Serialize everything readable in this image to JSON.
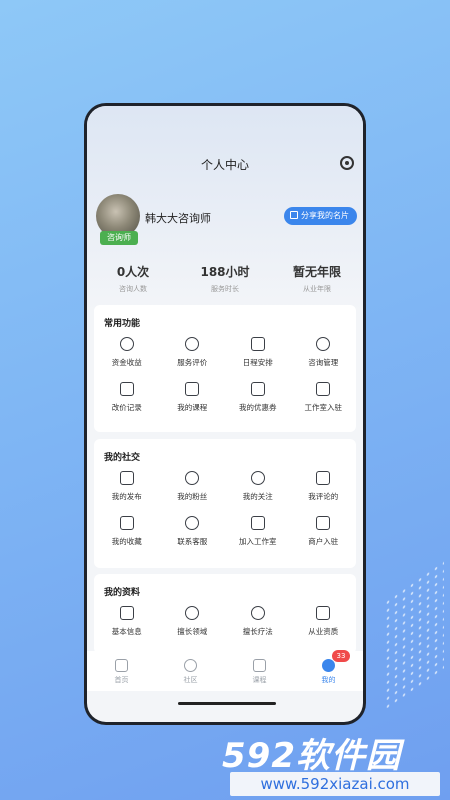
{
  "header": {
    "title": "个人中心"
  },
  "profile": {
    "name": "韩大大咨询师",
    "role_badge": "咨询师",
    "share_label": "分享我的名片"
  },
  "stats": [
    {
      "value": "0人次",
      "label": "咨询人数"
    },
    {
      "value": "188小时",
      "label": "服务时长"
    },
    {
      "value": "暂无年限",
      "label": "从业年限"
    }
  ],
  "sections": [
    {
      "title": "常用功能",
      "items": [
        {
          "label": "资金收益",
          "icon": "coin-icon"
        },
        {
          "label": "服务评价",
          "icon": "flower-icon"
        },
        {
          "label": "日程安排",
          "icon": "calendar-icon"
        },
        {
          "label": "咨询管理",
          "icon": "chat-search-icon"
        },
        {
          "label": "改价记录",
          "icon": "receipt-icon"
        },
        {
          "label": "我的课程",
          "icon": "book-icon"
        },
        {
          "label": "我的优惠券",
          "icon": "coupon-icon"
        },
        {
          "label": "工作室入驻",
          "icon": "house-icon"
        }
      ]
    },
    {
      "title": "我的社交",
      "items": [
        {
          "label": "我的发布",
          "icon": "send-icon"
        },
        {
          "label": "我的粉丝",
          "icon": "user-icon"
        },
        {
          "label": "我的关注",
          "icon": "heart-icon"
        },
        {
          "label": "我评论的",
          "icon": "comment-icon"
        },
        {
          "label": "我的收藏",
          "icon": "folder-icon"
        },
        {
          "label": "联系客服",
          "icon": "headset-icon"
        },
        {
          "label": "加入工作室",
          "icon": "briefcase-icon"
        },
        {
          "label": "商户入驻",
          "icon": "store-icon"
        }
      ]
    },
    {
      "title": "我的资料",
      "items": [
        {
          "label": "基本信息",
          "icon": "id-card-icon"
        },
        {
          "label": "擅长领域",
          "icon": "trophy-icon"
        },
        {
          "label": "擅长疗法",
          "icon": "pill-icon"
        },
        {
          "label": "从业资质",
          "icon": "certificate-icon"
        }
      ]
    }
  ],
  "tabbar": [
    {
      "label": "首页",
      "icon": "home-icon"
    },
    {
      "label": "社区",
      "icon": "planet-icon"
    },
    {
      "label": "课程",
      "icon": "course-icon"
    },
    {
      "label": "我的",
      "icon": "profile-icon",
      "badge": "33",
      "active": true
    }
  ],
  "watermark": {
    "logo": "592软件园",
    "url": "www.592xiazai.com"
  },
  "colors": {
    "accent": "#3b86ec",
    "badge": "#f04a4a",
    "role": "#4caf50"
  }
}
